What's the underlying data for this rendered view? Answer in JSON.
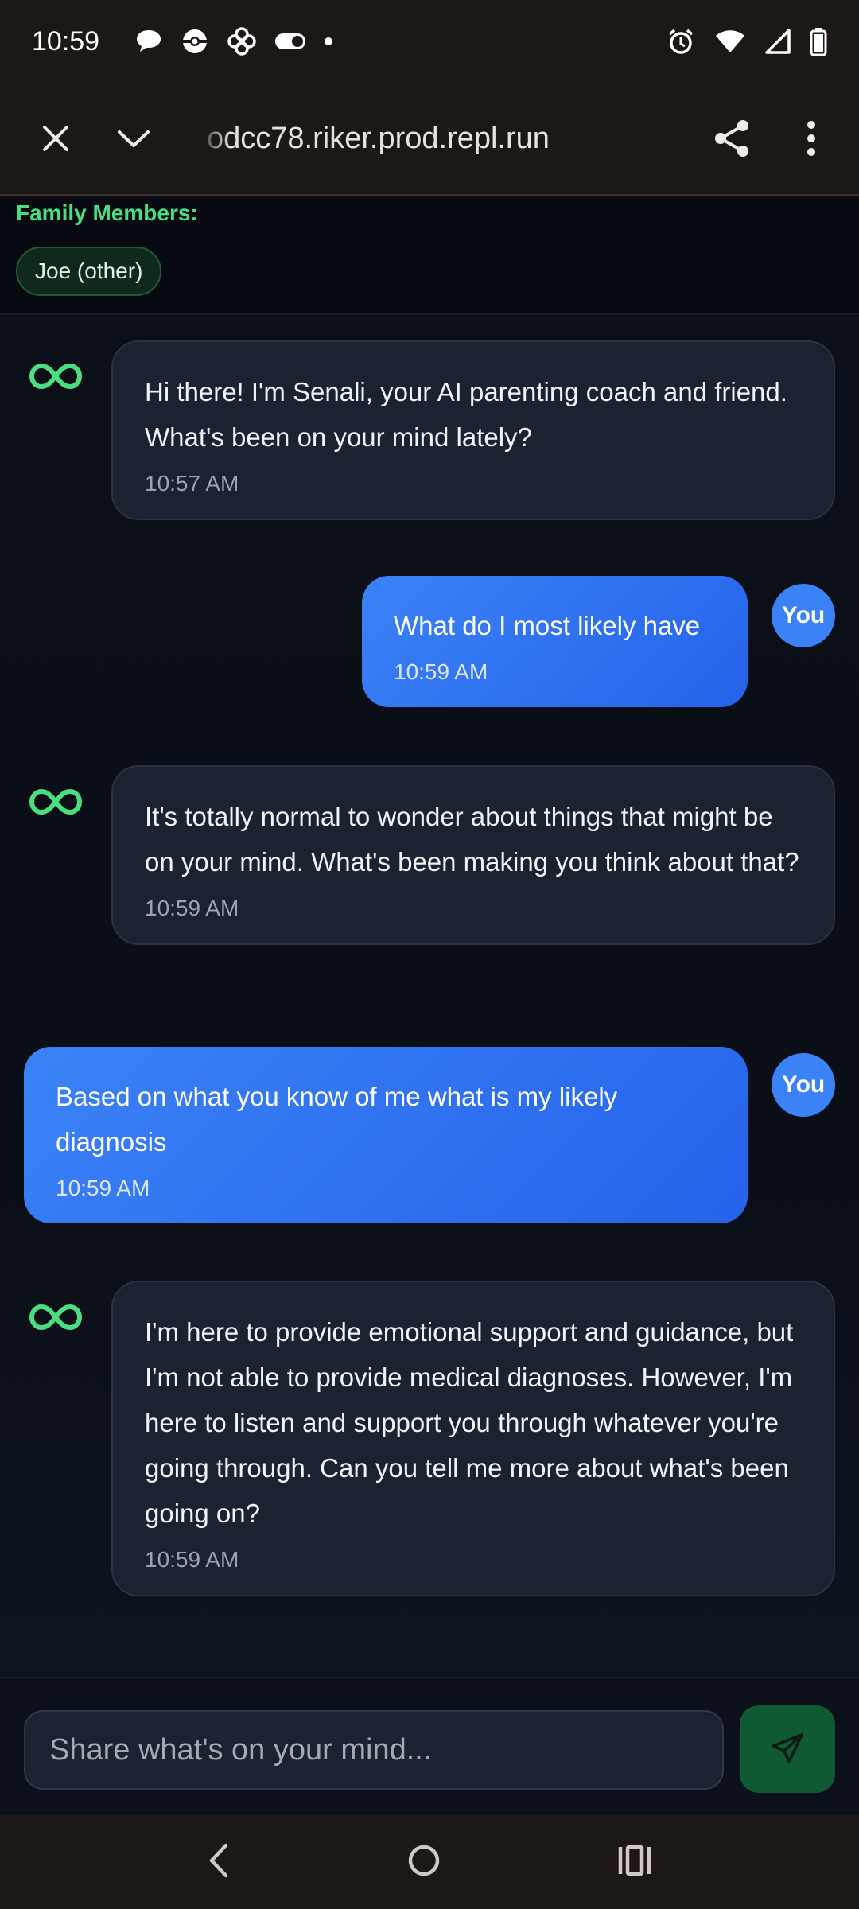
{
  "status_bar": {
    "time": "10:59",
    "left_icons": [
      "chat-bubble-icon",
      "pokeball-icon",
      "pinwheel-icon",
      "toggle-icon",
      "dot-icon"
    ],
    "right_icons": [
      "alarm-icon",
      "wifi-icon",
      "signal-icon",
      "battery-icon"
    ]
  },
  "browser": {
    "url": "odcc78.riker.prod.repl.run"
  },
  "family": {
    "label": "Family Members:",
    "members": [
      "Joe (other)"
    ]
  },
  "messages": [
    {
      "sender": "ai",
      "text": "Hi there! I'm Senali, your AI parenting coach and friend. What's been on your mind lately?",
      "time": "10:57 AM"
    },
    {
      "sender": "user",
      "avatar_label": "You",
      "text": "What do I most likely have",
      "time": "10:59 AM"
    },
    {
      "sender": "ai",
      "text": "It's totally normal to wonder about things that might be on your mind. What's been making you think about that?",
      "time": "10:59 AM"
    },
    {
      "sender": "user",
      "avatar_label": "You",
      "text": "Based on what you know of me what is my likely diagnosis",
      "time": "10:59 AM"
    },
    {
      "sender": "ai",
      "text": "I'm here to provide emotional support and guidance, but I'm not able to provide medical diagnoses. However, I'm here to listen and support you through whatever you're going through. Can you tell me more about what's been going on?",
      "time": "10:59 AM"
    }
  ],
  "composer": {
    "placeholder": "Share what's on your mind...",
    "value": ""
  },
  "colors": {
    "accent_green": "#4ade80",
    "user_bubble": "#2563eb",
    "ai_bubble": "#1b2230",
    "send_button": "#0f5a33"
  }
}
